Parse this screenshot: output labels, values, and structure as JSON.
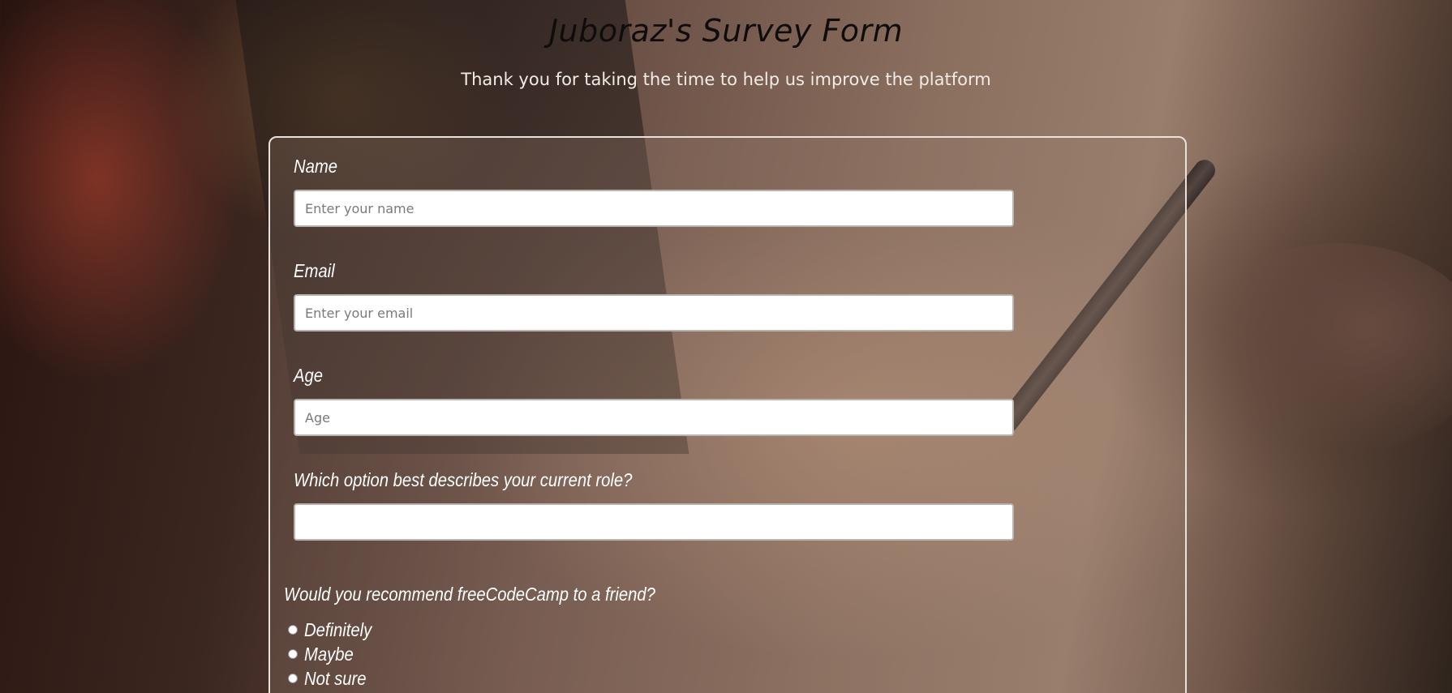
{
  "header": {
    "title": "Juboraz's Survey Form",
    "description": "Thank you for taking the time to help us improve the platform"
  },
  "form": {
    "name": {
      "label": "Name",
      "placeholder": "Enter your name",
      "value": ""
    },
    "email": {
      "label": "Email",
      "placeholder": "Enter your email",
      "value": ""
    },
    "age": {
      "label": "Age",
      "placeholder": "Age",
      "value": ""
    },
    "role": {
      "label": "Which option best describes your current role?",
      "selected": ""
    },
    "recommend": {
      "question": "Would you recommend freeCodeCamp to a friend?",
      "options": [
        "Definitely",
        "Maybe",
        "Not sure"
      ]
    }
  },
  "colors": {
    "title": "#0f0d0c",
    "text": "#ffffff",
    "card_border": "#e9e2dc"
  }
}
